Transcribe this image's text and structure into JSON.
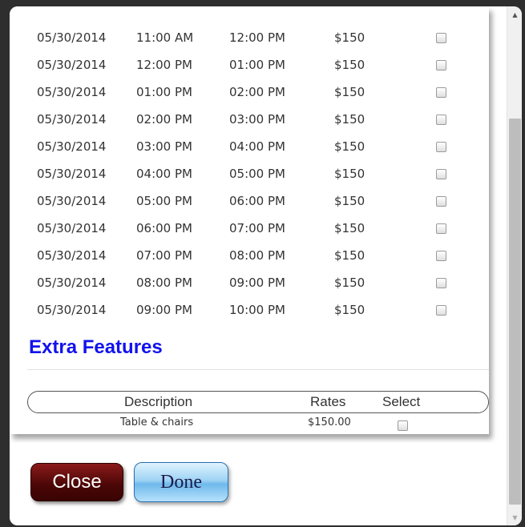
{
  "slots": [
    {
      "date": "05/30/2014",
      "start": "11:00 AM",
      "end": "12:00 PM",
      "price": "$150"
    },
    {
      "date": "05/30/2014",
      "start": "12:00 PM",
      "end": "01:00 PM",
      "price": "$150"
    },
    {
      "date": "05/30/2014",
      "start": "01:00 PM",
      "end": "02:00 PM",
      "price": "$150"
    },
    {
      "date": "05/30/2014",
      "start": "02:00 PM",
      "end": "03:00 PM",
      "price": "$150"
    },
    {
      "date": "05/30/2014",
      "start": "03:00 PM",
      "end": "04:00 PM",
      "price": "$150"
    },
    {
      "date": "05/30/2014",
      "start": "04:00 PM",
      "end": "05:00 PM",
      "price": "$150"
    },
    {
      "date": "05/30/2014",
      "start": "05:00 PM",
      "end": "06:00 PM",
      "price": "$150"
    },
    {
      "date": "05/30/2014",
      "start": "06:00 PM",
      "end": "07:00 PM",
      "price": "$150"
    },
    {
      "date": "05/30/2014",
      "start": "07:00 PM",
      "end": "08:00 PM",
      "price": "$150"
    },
    {
      "date": "05/30/2014",
      "start": "08:00 PM",
      "end": "09:00 PM",
      "price": "$150"
    },
    {
      "date": "05/30/2014",
      "start": "09:00 PM",
      "end": "10:00 PM",
      "price": "$150"
    }
  ],
  "extra_features": {
    "title": "Extra Features",
    "headers": {
      "description": "Description",
      "rates": "Rates",
      "select": "Select"
    },
    "items": [
      {
        "description": "Table & chairs",
        "rate": "$150.00"
      }
    ]
  },
  "buttons": {
    "close": "Close",
    "done": "Done"
  },
  "icons": {
    "scroll_up": "arrow-up-icon",
    "scroll_down": "arrow-down-icon"
  },
  "colors": {
    "section_title": "#1212ee",
    "close_button": "#5a0a0a",
    "done_button": "#8ccaf2"
  }
}
